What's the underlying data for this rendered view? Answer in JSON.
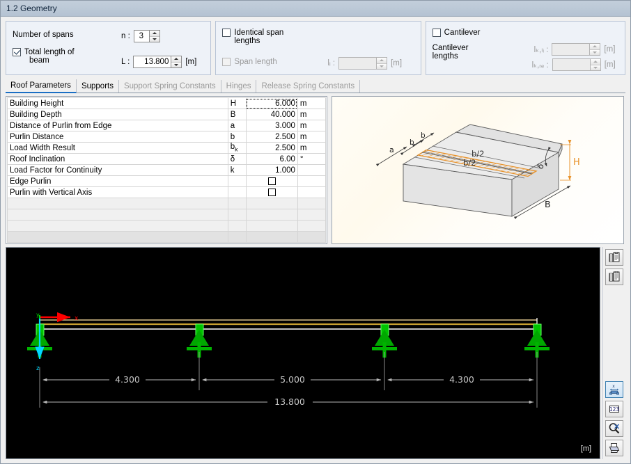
{
  "window": {
    "title": "1.2 Geometry"
  },
  "geometry": {
    "spans": {
      "label": "Number of spans",
      "symbol": "n :",
      "value": "3"
    },
    "total_length": {
      "checkbox_label_line1": "Total length of",
      "checkbox_label_line2": "beam",
      "checked": true,
      "symbol": "L :",
      "value": "13.800",
      "unit": "[m]"
    },
    "identical_spans": {
      "label_line1": "Identical span",
      "label_line2": "lengths",
      "checked": false
    },
    "span_length": {
      "label": "Span length",
      "checked": false,
      "symbol": "lᵢ :",
      "value": "",
      "unit": "[m]"
    },
    "cantilever": {
      "label": "Cantilever",
      "checked": false,
      "lengths_label_line1": "Cantilever",
      "lengths_label_line2": "lengths",
      "left_symbol": "lₖ,ₗᵢ :",
      "left_value": "",
      "left_unit": "[m]",
      "right_symbol": "lₖ,ᵣₑ :",
      "right_value": "",
      "right_unit": "[m]"
    }
  },
  "tabs": [
    {
      "label": "Roof Parameters",
      "state": "active"
    },
    {
      "label": "Supports",
      "state": "enabled"
    },
    {
      "label": "Support Spring Constants",
      "state": "disabled"
    },
    {
      "label": "Hinges",
      "state": "disabled"
    },
    {
      "label": "Release Spring Constants",
      "state": "disabled"
    }
  ],
  "parameter_table": {
    "rows": [
      {
        "description": "Building Height",
        "symbol": "H",
        "symbol_sub": "",
        "value": "6.000",
        "unit": "m",
        "type": "value",
        "focused": true
      },
      {
        "description": "Building Depth",
        "symbol": "B",
        "symbol_sub": "",
        "value": "40.000",
        "unit": "m",
        "type": "value",
        "focused": false
      },
      {
        "description": "Distance of Purlin from Edge",
        "symbol": "a",
        "symbol_sub": "",
        "value": "3.000",
        "unit": "m",
        "type": "value",
        "focused": false
      },
      {
        "description": "Purlin Distance",
        "symbol": "b",
        "symbol_sub": "",
        "value": "2.500",
        "unit": "m",
        "type": "value",
        "focused": false
      },
      {
        "description": "Load Width Result",
        "symbol": "b",
        "symbol_sub": "k",
        "value": "2.500",
        "unit": "m",
        "type": "value",
        "focused": false
      },
      {
        "description": "Roof Inclination",
        "symbol": "δ",
        "symbol_sub": "",
        "value": "6.00",
        "unit": "°",
        "type": "value",
        "focused": false
      },
      {
        "description": "Load Factor for Continuity",
        "symbol": "k",
        "symbol_sub": "",
        "value": "1.000",
        "unit": "",
        "type": "value",
        "focused": false
      },
      {
        "description": "Edge Purlin",
        "symbol": "",
        "symbol_sub": "",
        "value": "",
        "unit": "",
        "type": "checkbox",
        "checked": false
      },
      {
        "description": "Purlin with Vertical Axis",
        "symbol": "",
        "symbol_sub": "",
        "value": "",
        "unit": "",
        "type": "checkbox",
        "checked": false
      }
    ],
    "empty_rows": 4
  },
  "diagram_3d": {
    "labels": {
      "a": "a",
      "b_upper": "b",
      "b_lower": "b",
      "b_half_1": "b/2",
      "b_half_2": "b/2",
      "H": "H",
      "B": "B",
      "delta": "δ"
    },
    "colors": {
      "accent": "#e8922a",
      "body": "#e9e9e9",
      "outline": "#595959"
    }
  },
  "beam_render": {
    "unit": "[m]",
    "axis_x_label": "x",
    "axis_y_label": "y",
    "axis_z_label": "z",
    "span_dimensions": [
      "4.300",
      "5.000",
      "4.300"
    ],
    "total_dimension": "13.800",
    "support_count": 4,
    "colors": {
      "background": "#000000",
      "beam": "#c8a44a",
      "support": "#00b400",
      "dimension": "#b9b9b9",
      "axis_x": "#ff0000",
      "axis_z": "#00d8ff"
    }
  },
  "sidebar_buttons": [
    {
      "name": "copy-to-clipboard-1",
      "icon": "copy-icon",
      "selected": false
    },
    {
      "name": "copy-to-clipboard-2",
      "icon": "copy-icon",
      "selected": false
    },
    {
      "name": "show-dimensions",
      "icon": "dimension-icon",
      "selected": true
    },
    {
      "name": "show-numbering",
      "icon": "numbers-icon",
      "selected": false
    },
    {
      "name": "zoom-reset",
      "icon": "magnifier-icon",
      "selected": false
    },
    {
      "name": "print",
      "icon": "printer-icon",
      "selected": false
    }
  ]
}
